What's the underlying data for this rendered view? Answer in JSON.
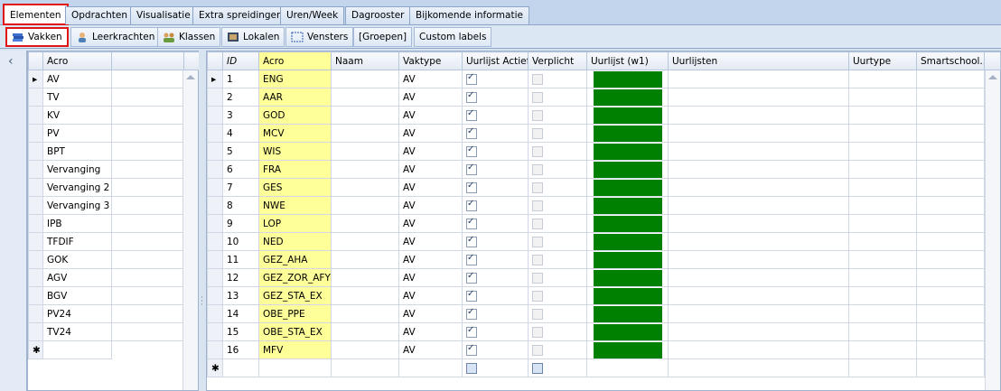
{
  "main_tabs": [
    {
      "label": "Elementen",
      "active": true
    },
    {
      "label": "Opdrachten"
    },
    {
      "label": "Visualisatie"
    },
    {
      "label": "Extra spreidingen"
    },
    {
      "label": "Uren/Week"
    },
    {
      "label": "Dagrooster"
    },
    {
      "label": "Bijkomende informatie"
    }
  ],
  "sub_tabs": [
    {
      "label": "Vakken",
      "icon": "books-icon",
      "active": true
    },
    {
      "label": "Leerkrachten",
      "icon": "teacher-icon"
    },
    {
      "label": "Klassen",
      "icon": "class-group-icon"
    },
    {
      "label": "Lokalen",
      "icon": "room-icon"
    },
    {
      "label": "Vensters",
      "icon": "window-select-icon"
    },
    {
      "label": "[Groepen]"
    },
    {
      "label": "Custom labels"
    }
  ],
  "left_grid": {
    "header": "Acro",
    "rows": [
      "AV",
      "TV",
      "KV",
      "PV",
      "BPT",
      "Vervanging",
      "Vervanging 2",
      "Vervanging 3",
      "IPB",
      "TFDIF",
      "GOK",
      "AGV",
      "BGV",
      "PV24",
      "TV24"
    ],
    "current_marker": "▸",
    "new_row_marker": "✱"
  },
  "right_grid": {
    "columns": {
      "id": "ID",
      "acro": "Acro",
      "naam": "Naam",
      "vaktype": "Vaktype",
      "uurlijst_actief": "Uurlijst Actief",
      "verplicht": "Verplicht",
      "uurlijst_w1": "Uurlijst (w1)",
      "uurlijsten": "Uurlijsten",
      "uurtype": "Uurtype",
      "smartschool": "Smartschool..."
    },
    "rows": [
      {
        "id": "1",
        "acro": "ENG",
        "vaktype": "AV"
      },
      {
        "id": "2",
        "acro": "AAR",
        "vaktype": "AV"
      },
      {
        "id": "3",
        "acro": "GOD",
        "vaktype": "AV"
      },
      {
        "id": "4",
        "acro": "MCV",
        "vaktype": "AV"
      },
      {
        "id": "5",
        "acro": "WIS",
        "vaktype": "AV"
      },
      {
        "id": "6",
        "acro": "FRA",
        "vaktype": "AV"
      },
      {
        "id": "7",
        "acro": "GES",
        "vaktype": "AV"
      },
      {
        "id": "8",
        "acro": "NWE",
        "vaktype": "AV"
      },
      {
        "id": "9",
        "acro": "LOP",
        "vaktype": "AV"
      },
      {
        "id": "10",
        "acro": "NED",
        "vaktype": "AV"
      },
      {
        "id": "11",
        "acro": "GEZ_AHA",
        "vaktype": "AV"
      },
      {
        "id": "12",
        "acro": "GEZ_ZOR_AFY",
        "vaktype": "AV"
      },
      {
        "id": "13",
        "acro": "GEZ_STA_EX",
        "vaktype": "AV"
      },
      {
        "id": "14",
        "acro": "OBE_PPE",
        "vaktype": "AV"
      },
      {
        "id": "15",
        "acro": "OBE_STA_EX",
        "vaktype": "AV"
      },
      {
        "id": "16",
        "acro": "MFV",
        "vaktype": "AV"
      }
    ],
    "uurlijst_actief_checked": true,
    "verplicht_checked": false,
    "uurlijst_w1_color": "#008000",
    "acro_highlight_color": "#ffff99",
    "current_marker": "▸",
    "new_row_marker": "✱"
  },
  "collapse_icon": "chevron-left-icon",
  "collapse_glyph": "‹"
}
